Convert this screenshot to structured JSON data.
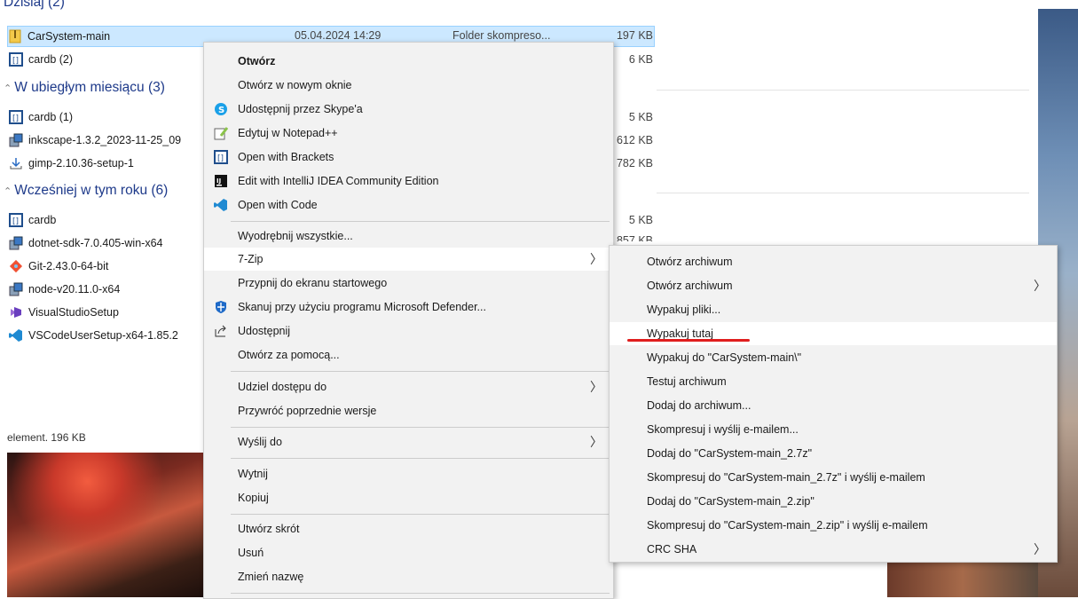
{
  "explorer": {
    "partial_group": "Dzisiaj (2)",
    "groups": [
      "W ubiegłym miesiącu (3)",
      "Wcześniej w tym roku (6)"
    ],
    "selected_file": {
      "name": "CarSystem-main",
      "date": "05.04.2024 14:29",
      "type": "Folder skompreso...",
      "size": "197 KB"
    },
    "files": [
      {
        "name": "cardb (2)",
        "size": "6 KB"
      },
      {
        "name": "cardb (1)",
        "size": "5 KB"
      },
      {
        "name": "inkscape-1.3.2_2023-11-25_09",
        "size": "612 KB"
      },
      {
        "name": "gimp-2.10.36-setup-1",
        "size": "782 KB"
      },
      {
        "name": "cardb",
        "size": "5 KB"
      },
      {
        "name": "dotnet-sdk-7.0.405-win-x64",
        "size": "857 KB"
      },
      {
        "name": "Git-2.43.0-64-bit"
      },
      {
        "name": "node-v20.11.0-x64"
      },
      {
        "name": "VisualStudioSetup"
      },
      {
        "name": "VSCodeUserSetup-x64-1.85.2"
      }
    ],
    "status": "element. 196 KB"
  },
  "context_menu": {
    "items": [
      {
        "label": "Otwórz",
        "icon": "none"
      },
      {
        "label": "Otwórz w nowym oknie",
        "icon": "none"
      },
      {
        "label": "Udostępnij przez Skype'a",
        "icon": "skype-icon"
      },
      {
        "label": "Edytuj w Notepad++",
        "icon": "notepadpp-icon"
      },
      {
        "label": "Open with Brackets",
        "icon": "brackets-icon"
      },
      {
        "label": "Edit with IntelliJ IDEA Community Edition",
        "icon": "intellij-icon"
      },
      {
        "label": "Open with Code",
        "icon": "vscode-icon"
      },
      {
        "label": "Wyodrębnij wszystkie...",
        "icon": "none"
      },
      {
        "label": "7-Zip",
        "icon": "none",
        "submenu": true
      },
      {
        "label": "Przypnij do ekranu startowego",
        "icon": "none"
      },
      {
        "label": "Skanuj przy użyciu programu Microsoft Defender...",
        "icon": "defender-icon"
      },
      {
        "label": "Udostępnij",
        "icon": "share-icon"
      },
      {
        "label": "Otwórz za pomocą...",
        "icon": "none"
      },
      {
        "label": "Udziel dostępu do",
        "icon": "none",
        "submenu": true
      },
      {
        "label": "Przywróć poprzednie wersje",
        "icon": "none"
      },
      {
        "label": "Wyślij do",
        "icon": "none",
        "submenu": true
      },
      {
        "label": "Wytnij",
        "icon": "none"
      },
      {
        "label": "Kopiuj",
        "icon": "none"
      },
      {
        "label": "Utwórz skrót",
        "icon": "none"
      },
      {
        "label": "Usuń",
        "icon": "none"
      },
      {
        "label": "Zmień nazwę",
        "icon": "none"
      }
    ]
  },
  "zip_submenu": {
    "items": [
      {
        "label": "Otwórz archiwum"
      },
      {
        "label": "Otwórz archiwum",
        "submenu": true
      },
      {
        "label": "Wypakuj pliki..."
      },
      {
        "label": "Wypakuj tutaj",
        "highlighted": true
      },
      {
        "label": "Wypakuj do \"CarSystem-main\\\""
      },
      {
        "label": "Testuj archiwum"
      },
      {
        "label": "Dodaj do archiwum..."
      },
      {
        "label": "Skompresuj i wyślij e-mailem..."
      },
      {
        "label": "Dodaj do \"CarSystem-main_2.7z\""
      },
      {
        "label": "Skompresuj do \"CarSystem-main_2.7z\" i wyślij e-mailem"
      },
      {
        "label": "Dodaj do \"CarSystem-main_2.zip\""
      },
      {
        "label": "Skompresuj do \"CarSystem-main_2.zip\" i wyślij e-mailem"
      },
      {
        "label": "CRC SHA",
        "submenu": true
      }
    ]
  },
  "colors": {
    "selection": "#cce8ff",
    "group_heading": "#1e3a8a",
    "menu_bg": "#f2f2f2",
    "annotation": "#e01e1e"
  }
}
